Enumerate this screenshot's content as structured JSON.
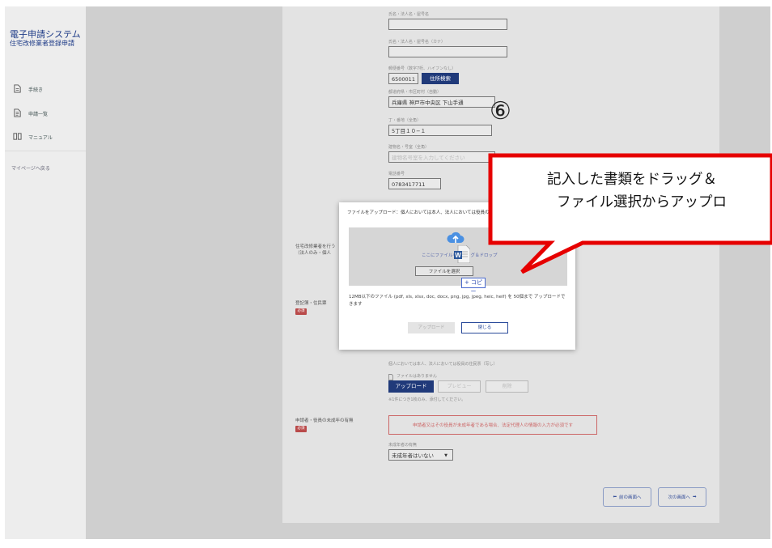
{
  "sidebar": {
    "app_title": "電子申請システム",
    "app_subtitle": "住宅改修業者登録申請",
    "items": [
      {
        "label": "手続き",
        "icon": "document-icon"
      },
      {
        "label": "申請一覧",
        "icon": "document-list-icon"
      },
      {
        "label": "マニュアル",
        "icon": "manual-icon"
      }
    ],
    "mypage_link": "マイページへ戻る"
  },
  "form": {
    "name_label": "氏名・法人名・屋号名",
    "kana_label": "氏名・法人名・屋号名（カナ）",
    "postal_label": "郵便番号（数字7桁、ハイフンなし）",
    "postal_value": "6500011",
    "address_search_btn": "住所検索",
    "city_label": "都道府県・市区町村（自動）",
    "city_value": "兵庫県 神戸市中央区 下山手通",
    "chome_label": "丁・番地（全角）",
    "chome_value": "5丁目１０−１",
    "building_label": "建物名・号室（全角）",
    "building_placeholder": "建物名号室を入力してください",
    "phone_label": "電話番号",
    "phone_value": "0783417711",
    "left_label_1": "住宅改修業者を行う",
    "left_label_2": "（法人のみ・個人",
    "doc_left_label": "登記簿・住民票",
    "required_badge": "必須",
    "doc_note": "個人においては本人、法人においては役員の住民票（写し）",
    "no_file": "ファイルはありません",
    "upload_btn": "アップロード",
    "preview_btn": "プレビュー",
    "delete_btn": "削除",
    "file_limit_note": "※1件につき1枚のみ、添付してください。",
    "minor_left_label": "申請者・役員の未成年の有無",
    "minor_error": "申請者又はその役員が未成年者である場合、法定代理人の情報の入力が必須です",
    "minor_select_label": "未成年者の有無",
    "minor_select_value": "未成年者はいない",
    "prev_btn": "前の画面へ",
    "next_btn": "次の画面へ"
  },
  "modal": {
    "title": "ファイルをアップロード：個人においては本人、法人においては役員の",
    "drop_text": "ここにファイルをドラッグ＆ドロップ",
    "select_btn": "ファイルを選択",
    "note": "12MB以下のファイル (pdf, xls, xlsx, doc, docx, png, jpg, jpeg, heic, heif) を 50個まで アップロードできます",
    "upload_btn": "アップロード",
    "close_btn": "閉じる"
  },
  "overlay": {
    "copy_badge": "+ コピー",
    "step_number": "⑥",
    "callout_line1": "記入した書類をドラッグ＆",
    "callout_line2": "ファイル選択からアップロ",
    "callout_color": "#e60000"
  }
}
